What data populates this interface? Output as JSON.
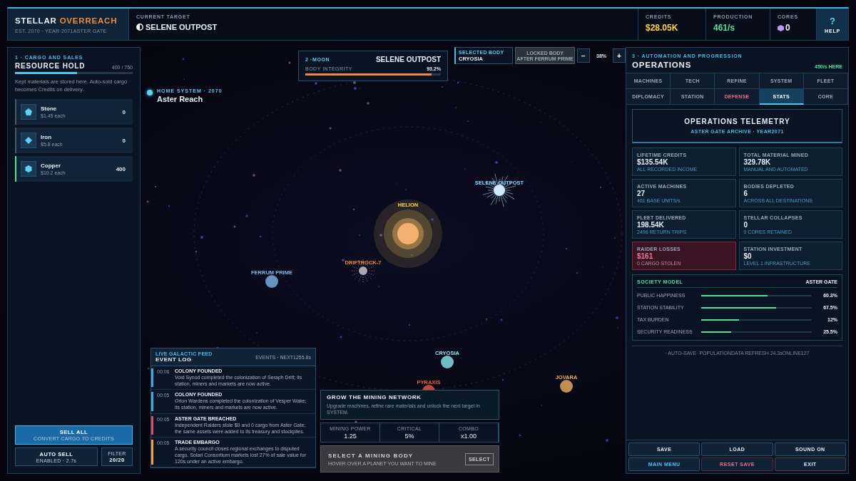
{
  "header": {
    "brand": "STELLAR",
    "brand_accent": "OVERREACH",
    "subtitle": "EST. 2070 · YEAR·2071ASTER GATE",
    "target_label": "CURRENT TARGET",
    "target": "SELENE OUTPOST",
    "stats": [
      {
        "kind": "credits",
        "label": "CREDITS",
        "value": "$28.05K"
      },
      {
        "kind": "production",
        "label": "PRODUCTION",
        "value": "461/s"
      },
      {
        "kind": "cores",
        "label": "CORES",
        "value": "0"
      }
    ],
    "help": {
      "icon": "?",
      "label": "HELP"
    }
  },
  "cargo": {
    "section": "1 · CARGO AND SALES",
    "title": "RESOURCE HOLD",
    "capacity": "400 / 750",
    "level": 0.53,
    "description": "Kept materials are stored here. Auto-sold cargo becomes Credits on delivery.",
    "resources": [
      {
        "kind": "stone",
        "name": "Stone",
        "price": "$1.45 each",
        "amount": "0",
        "active": false
      },
      {
        "kind": "iron",
        "name": "Iron",
        "price": "$5.8 each",
        "amount": "0",
        "active": false
      },
      {
        "kind": "copper",
        "name": "Copper",
        "price": "$10.2 each",
        "amount": "400",
        "active": true
      }
    ],
    "sell_all": {
      "label": "SELL ALL",
      "sub": "CONVERT CARGO TO CREDITS"
    },
    "auto_sell": {
      "label": "AUTO SELL",
      "sub": "ENABLED · 2.7s"
    },
    "filter": {
      "label": "FILTER",
      "value": "20/20"
    }
  },
  "map": {
    "home": {
      "label": "HOME SYSTEM · 2070",
      "name": "Aster Reach"
    },
    "bodies": [
      {
        "kind": "star",
        "name": "HELION",
        "color": "#ffd45a"
      },
      {
        "kind": "station",
        "name": "SELENE OUTPOST",
        "color": "#8fd8ff"
      },
      {
        "kind": "asteroid",
        "name": "DRIFTROCK-7",
        "color": "#f08a3c"
      },
      {
        "kind": "planet",
        "name": "FERRUM PRIME",
        "color": "#7fb4e8"
      },
      {
        "kind": "planet",
        "name": "CRYOSIA",
        "color": "#8ee8f0"
      },
      {
        "kind": "planet",
        "name": "PYRAXIS",
        "color": "#f05a3c"
      },
      {
        "kind": "planet",
        "name": "JOVARA",
        "color": "#f0b060"
      }
    ]
  },
  "target_card": {
    "kicker": "2 ·MOON",
    "name": "SELENE OUTPOST",
    "label": "BODY INTEGRITY",
    "reading": "93.2%",
    "level": 0.93
  },
  "selection": {
    "selected_label": "SELECTED BODY",
    "selected": "CRYOSIA",
    "locked_label": "LOCKED BODY",
    "locked_sub": "AFTER FERRUM PRIME",
    "zoom_out": "−",
    "zoom": "38%",
    "zoom_in": "+"
  },
  "operations": {
    "section": "3 · AUTOMATION AND PROGRESSION",
    "title": "OPERATIONS",
    "rate": "450/s HERE",
    "tabs": [
      {
        "label": "MACHINES",
        "selected": false,
        "alert": false
      },
      {
        "label": "TECH",
        "selected": false,
        "alert": false
      },
      {
        "label": "REFINE",
        "selected": false,
        "alert": false
      },
      {
        "label": "SYSTEM",
        "selected": false,
        "alert": false
      },
      {
        "label": "FLEET",
        "selected": false,
        "alert": false
      },
      {
        "label": "DIPLOMACY",
        "selected": false,
        "alert": false
      },
      {
        "label": "STATION",
        "selected": false,
        "alert": false
      },
      {
        "label": "DEFENSE",
        "selected": false,
        "alert": true
      },
      {
        "label": "STATS",
        "selected": true,
        "alert": false
      },
      {
        "label": "CORE",
        "selected": false,
        "alert": false
      }
    ],
    "telemetry": {
      "title": "OPERATIONS TELEMETRY",
      "subtitle": "ASTER GATE ARCHIVE · YEAR2071"
    },
    "stats": [
      {
        "label": "LIFETIME CREDITS",
        "value": "$135.54K",
        "note": "ALL RECORDED INCOME",
        "alert": false
      },
      {
        "label": "TOTAL MATERIAL MINED",
        "value": "329.78K",
        "note": "MANUAL AND AUTOMATED",
        "alert": false
      },
      {
        "label": "ACTIVE MACHINES",
        "value": "27",
        "note": "461 BASE UNITS/s",
        "alert": false
      },
      {
        "label": "BODIES DEPLETED",
        "value": "6",
        "note": "ACROSS ALL DESTINATIONS",
        "alert": false
      },
      {
        "label": "FLEET DELIVERED",
        "value": "198.54K",
        "note": "2496 RETURN TRIPS",
        "alert": false
      },
      {
        "label": "STELLAR COLLAPSES",
        "value": "0",
        "note": "0 CORES RETAINED",
        "alert": false
      },
      {
        "label": "RAIDER LOSSES",
        "value": "$161",
        "note": "0 CARGO STOLEN",
        "alert": true
      },
      {
        "label": "STATION INVESTMENT",
        "value": "$0",
        "note": "LEVEL 1 INFRASTRUCTURE",
        "alert": false
      }
    ],
    "society": {
      "title": "SOCIETY MODEL",
      "place": "ASTER GATE",
      "rows": [
        {
          "label": "PUBLIC HAPPINESS",
          "level": 0.6,
          "reading": "60.3%"
        },
        {
          "label": "STATION STABILITY",
          "level": 0.68,
          "reading": "67.5%"
        },
        {
          "label": "TAX BURDEN",
          "level": 0.34,
          "reading": "12%"
        },
        {
          "label": "SECURITY READINESS",
          "level": 0.27,
          "reading": "25.5%"
        }
      ]
    },
    "footer_note": "· AUTO-SAVE· POPULATIONDATA REFRESH 24.3sONLINE127",
    "buttons": [
      {
        "label": "SAVE",
        "kind": "normal"
      },
      {
        "label": "LOAD",
        "kind": "normal"
      },
      {
        "label": "SOUND ON",
        "kind": "normal"
      },
      {
        "label": "MAIN MENU",
        "kind": "primary"
      },
      {
        "label": "RESET SAVE",
        "kind": "danger"
      },
      {
        "label": "EXIT",
        "kind": "exit"
      }
    ]
  },
  "event_log": {
    "kicker": "LIVE GALACTIC FEED",
    "title": "EVENT LOG",
    "meta": "EVENTS · NEXT1255.8s",
    "entries": [
      {
        "time": "00:06",
        "title": "COLONY FOUNDED",
        "text": "Void Synod completed the colonization of Seraph Drift; its station, miners and markets are now active.",
        "color": "#3fa8d8"
      },
      {
        "time": "00:05",
        "title": "COLONY FOUNDED",
        "text": "Orion Wardens completed the colonization of Vesper Wake; its station, miners and markets are now active.",
        "color": "#3fa8d8"
      },
      {
        "time": "00:05",
        "title": "ASTER GATE BREACHED",
        "text": "Independent Raiders stole $0 and 0 cargo from Aster Gate; the same assets were added to its treasury and stockpiles.",
        "color": "#d84a6a"
      },
      {
        "time": "00:05",
        "title": "TRADE EMBARGO",
        "text": "A security council closes regional exchanges to disputed cargo. Solari Consortium markets lost 27% of sale value for 120s under an active embargo.",
        "color": "#f0a040"
      }
    ]
  },
  "mining": {
    "title": "GROW THE MINING NETWORK",
    "text": "Upgrade machines, refine rare materials and unlock the next target in SYSTEM.",
    "stats": [
      {
        "label": "MINING POWER",
        "value": "1.25"
      },
      {
        "label": "CRITICAL",
        "value": "5%"
      },
      {
        "label": "COMBO",
        "value": "x1.00"
      }
    ],
    "select": {
      "title": "SELECT A MINING BODY",
      "sub": "HOVER OVER A PLANET YOU WANT TO MINE",
      "button": "SELECT"
    }
  }
}
